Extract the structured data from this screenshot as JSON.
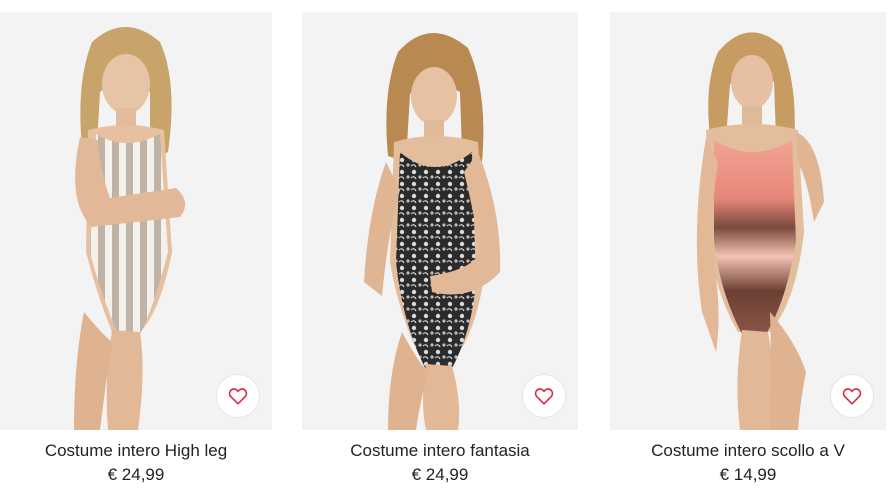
{
  "products": [
    {
      "name": "Costume intero High leg",
      "price": "€ 24,99",
      "favorite_icon": "heart-outline-icon",
      "swimsuit_pattern": "beige-white-vertical-stripes"
    },
    {
      "name": "Costume intero fantasia",
      "price": "€ 24,99",
      "favorite_icon": "heart-outline-icon",
      "swimsuit_pattern": "black-white-paisley"
    },
    {
      "name": "Costume intero scollo a V",
      "price": "€ 14,99",
      "favorite_icon": "heart-outline-icon",
      "swimsuit_pattern": "pink-brown-tie-dye"
    }
  ],
  "colors": {
    "photo_background": "#f3f3f3",
    "favorite_heart": "#d6334a",
    "text": "#222222"
  }
}
